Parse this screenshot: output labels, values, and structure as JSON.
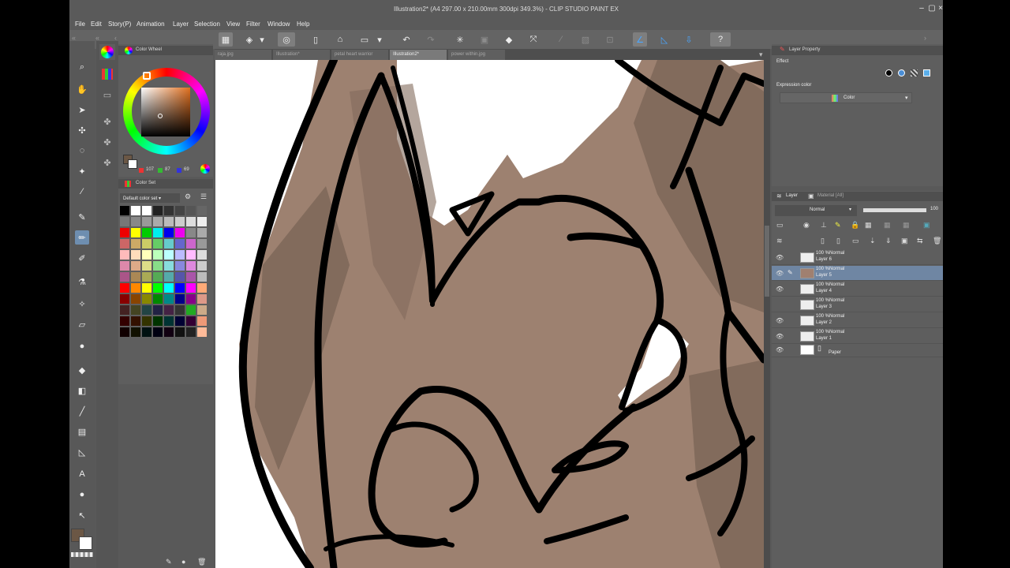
{
  "title": "Illustration2* (A4 297.00 x 210.00mm 300dpi 349.3%) - CLIP STUDIO PAINT EX",
  "menu": [
    "File",
    "Edit",
    "Story(P)",
    "Animation",
    "Layer",
    "Selection",
    "View",
    "Filter",
    "Window",
    "Help"
  ],
  "doc_tabs": [
    "raja.jpg",
    "Illustration*",
    "petal heart warrior",
    "Illustration2*",
    "power within.jpg"
  ],
  "color_wheel": {
    "tab_label": "Color Wheel",
    "r": "107",
    "g": "87",
    "b": "69"
  },
  "color_set": {
    "tab_label": "Color Set",
    "set_name": "Default color set"
  },
  "layer_property": {
    "tab_label": "Layer Property",
    "effect_label": "Effect",
    "expression_label": "Expression color",
    "expression_value": "Color"
  },
  "layers_panel": {
    "tab_label": "Layer",
    "tab2_label": "Material [All]",
    "blend_mode": "Normal",
    "opacity": "100",
    "layers": [
      {
        "mode": "100 %Normal",
        "name": "Layer 6",
        "visible": true,
        "selected": false
      },
      {
        "mode": "100 %Normal",
        "name": "Layer 5",
        "visible": true,
        "selected": true
      },
      {
        "mode": "100 %Normal",
        "name": "Layer 4",
        "visible": true,
        "selected": false
      },
      {
        "mode": "100 %Normal",
        "name": "Layer 3",
        "visible": false,
        "selected": false
      },
      {
        "mode": "100 %Normal",
        "name": "Layer 2",
        "visible": true,
        "selected": false
      },
      {
        "mode": "100 %Normal",
        "name": "Layer 1",
        "visible": true,
        "selected": false
      }
    ],
    "paper": "Paper"
  },
  "colors": {
    "main": "#6b5745",
    "light_fur": "#9d8170",
    "dark_fur": "#826b5c",
    "line": "#000000",
    "layer_selected": "#6f86a3"
  }
}
